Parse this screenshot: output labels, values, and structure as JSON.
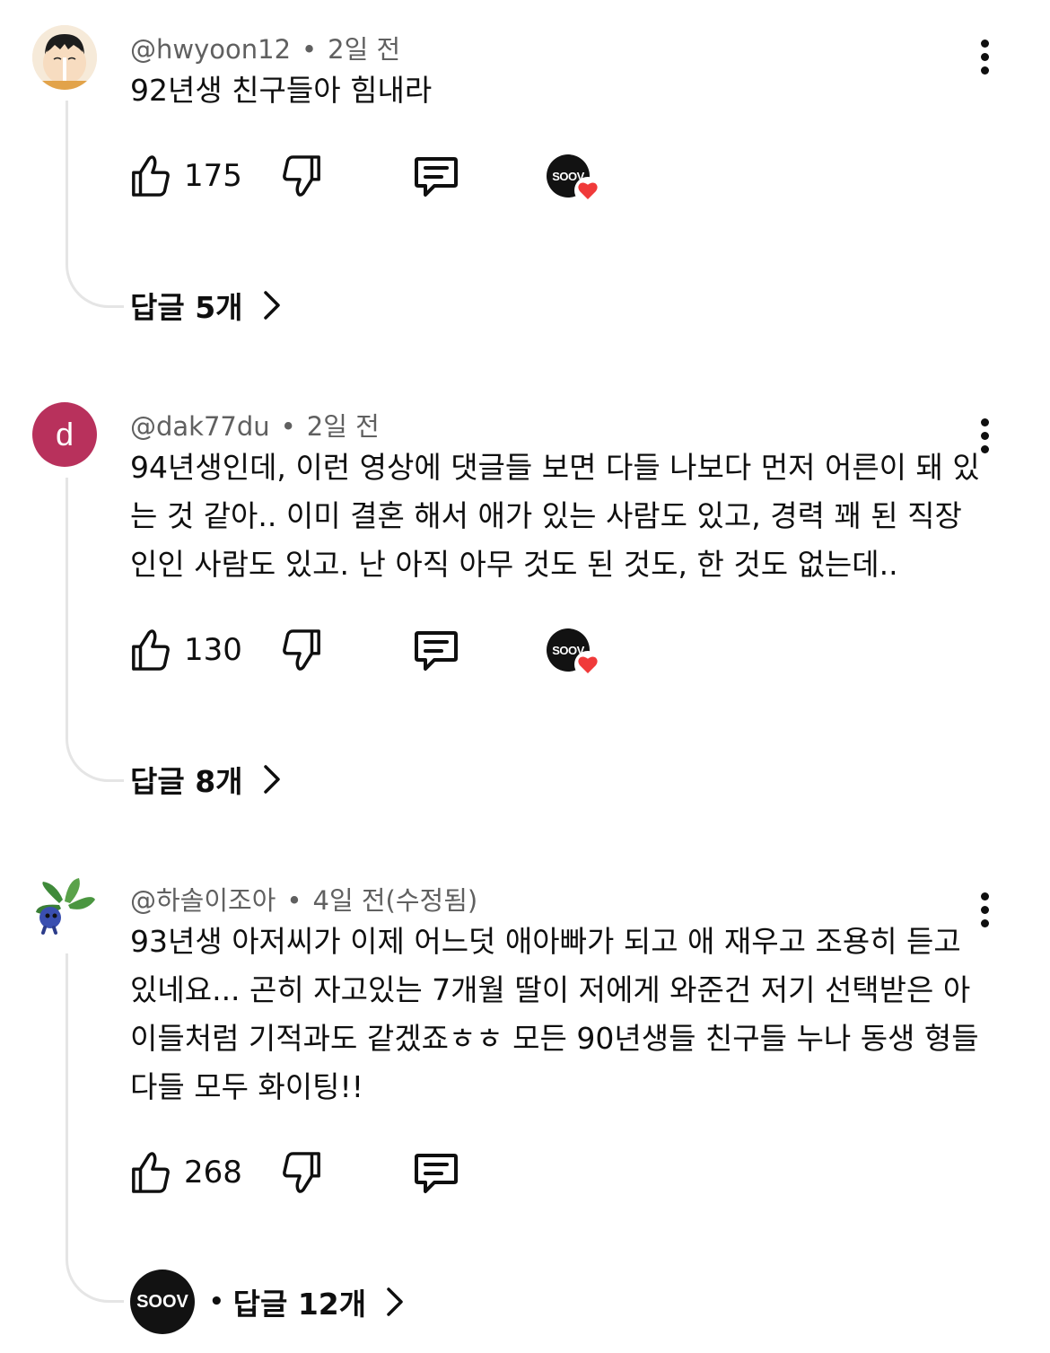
{
  "comments": [
    {
      "username": "@hwyoon12",
      "time": "2일 전",
      "text": "92년생 친구들아 힘내라",
      "likes": "175",
      "creator_badge": "SOOV",
      "replies_label": "답글 5개"
    },
    {
      "username": "@dak77du",
      "time": "2일 전",
      "avatar_letter": "d",
      "text": "94년생인데, 이런 영상에 댓글들 보면 다들 나보다 먼저 어른이 돼 있는 것 같아.. 이미 결혼 해서 애가 있는 사람도 있고, 경력 꽤 된 직장인인 사람도 있고. 난 아직 아무 것도 된 것도, 한 것도 없는데..",
      "likes": "130",
      "creator_badge": "SOOV",
      "replies_label": "답글 8개"
    },
    {
      "username": "@하솔이조아",
      "time": "4일 전(수정됨)",
      "text": "93년생 아저씨가 이제 어느덧 애아빠가 되고 애 재우고 조용히 듣고있네요... 곤히 자고있는 7개월 딸이 저에게 와준건 저기 선택받은 아이들처럼 기적과도 같겠죠ㅎㅎ 모든 90년생들 친구들 누나 동생 형들 다들 모두 화이팅!!",
      "likes": "268",
      "creator_badge": "SOOV",
      "replies_label": "답글 12개"
    }
  ],
  "colors": {
    "avatar_d": "#b8315c",
    "heart": "#f03a3a",
    "line": "#e5e5e5"
  },
  "icons": [
    "like-icon",
    "dislike-icon",
    "reply-icon",
    "more-vert-icon",
    "chevron-right-icon",
    "heart-icon"
  ]
}
